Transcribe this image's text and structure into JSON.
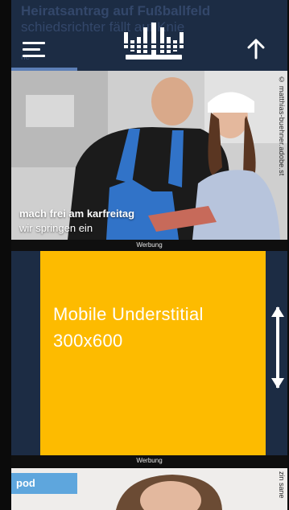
{
  "header": {
    "ghost_title_line1": "Heiratsantrag auf Fußballfeld",
    "ghost_title_line2": "schiedsrichter fällt auf Knie",
    "ghost_tag": "ne"
  },
  "icons": {
    "menu": "hamburger-menu-icon",
    "logo": "crown-logo",
    "up": "arrow-up-icon",
    "ad_resize": "double-arrow-vertical-icon"
  },
  "teaser": {
    "title": "mach frei am karfreitag",
    "subtitle": "wir springen ein",
    "credit": "© matthias-buehner.adobe.st"
  },
  "ad": {
    "label_top": "Werbung",
    "line1": "Mobile Understitial",
    "line2": "300x600",
    "label_bottom": "Werbung",
    "color": "#fdbb00"
  },
  "teaser2": {
    "badge": "pod",
    "credit": "zin sane"
  },
  "colors": {
    "header_bg": "#1c2c44",
    "accent_blue": "#5ea6dd"
  }
}
